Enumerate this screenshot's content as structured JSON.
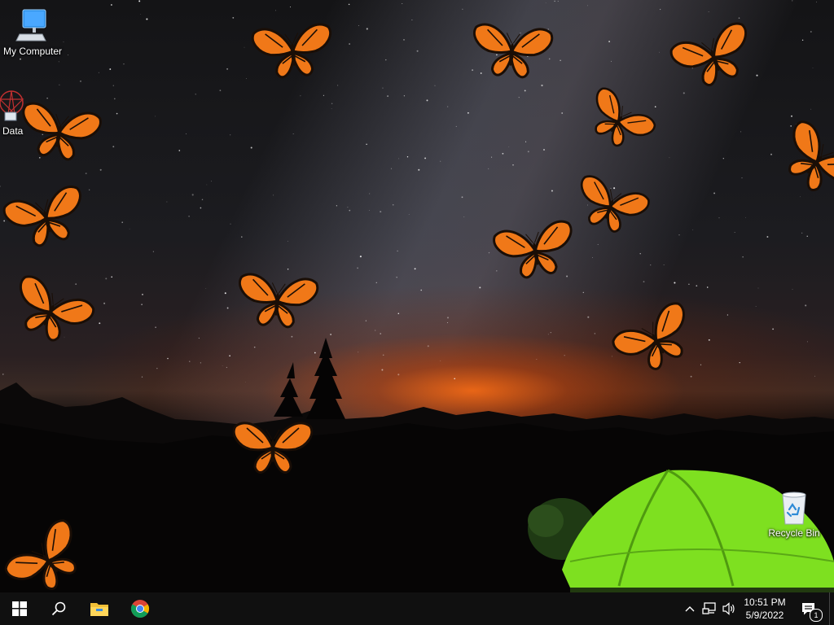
{
  "desktop": {
    "icons": [
      {
        "label": "My Computer",
        "icon": "computer-icon"
      },
      {
        "label": "Data",
        "icon": "data-app-icon"
      },
      {
        "label": "Recycle Bin",
        "icon": "recycle-bin-icon"
      }
    ],
    "wallpaper": "night-sky-camping-tent-with-butterflies"
  },
  "taskbar": {
    "start": "windows-start-icon",
    "search": "search-icon",
    "pinned": [
      "file-explorer-icon",
      "chrome-icon"
    ],
    "tray": {
      "chevron": "show-hidden-icons",
      "network": "network-icon",
      "volume": "volume-icon",
      "time": "10:51 PM",
      "date": "5/9/2022",
      "notifications_badge": "1"
    }
  },
  "colors": {
    "taskbar": "#101010",
    "butterfly_orange": "#f07818",
    "tent_green": "#7ee020"
  }
}
